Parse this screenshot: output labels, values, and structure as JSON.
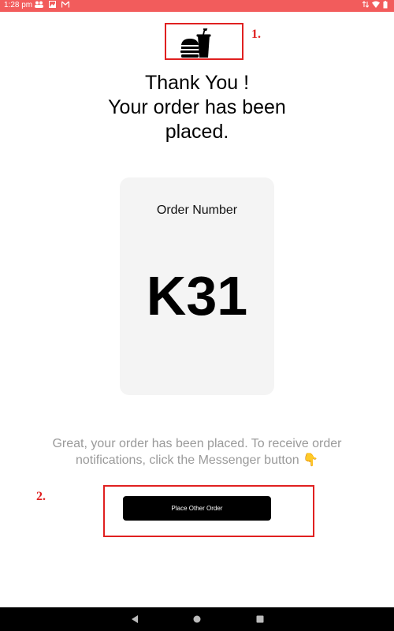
{
  "status_bar": {
    "time": "1:28 pm",
    "left_icons": [
      "people-icon",
      "image-icon",
      "gmail-icon"
    ],
    "right_icons": [
      "data-icon",
      "wifi-icon",
      "battery-icon"
    ]
  },
  "annotations": {
    "first": "1.",
    "second": "2."
  },
  "logo": {
    "icon": "burger-and-drink-icon"
  },
  "thank_you": {
    "line1": "Thank You !",
    "line2": "Your order has been",
    "line3": "placed."
  },
  "order_card": {
    "label": "Order Number",
    "number": "K31"
  },
  "info": {
    "text": "Great, your order has been placed. To receive order notifications, click the Messenger button",
    "emoji": "👇"
  },
  "place_button": {
    "label": "Place Other Order"
  },
  "nav_bar": {
    "icons": [
      "back-icon",
      "home-icon",
      "recent-apps-icon"
    ]
  },
  "colors": {
    "status_bar": "#f25c5c",
    "annotation": "#e02020",
    "card_bg": "#f4f4f4",
    "button_bg": "#000000",
    "info_text": "#9a9a9a"
  }
}
